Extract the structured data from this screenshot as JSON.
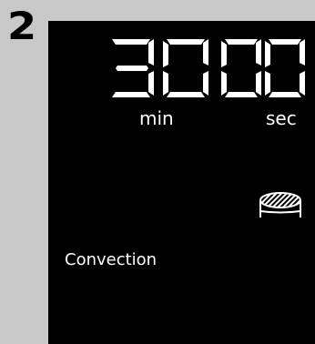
{
  "step": {
    "number": "2"
  },
  "display": {
    "minutes": "30",
    "seconds": "00",
    "minutes_unit": "min",
    "seconds_unit": "sec",
    "mode": "Convection",
    "indicator_icon": "convection-pan-icon"
  },
  "colors": {
    "panel_bg": "#c8c8c8",
    "display_bg": "#000000",
    "display_fg": "#ffffff"
  }
}
